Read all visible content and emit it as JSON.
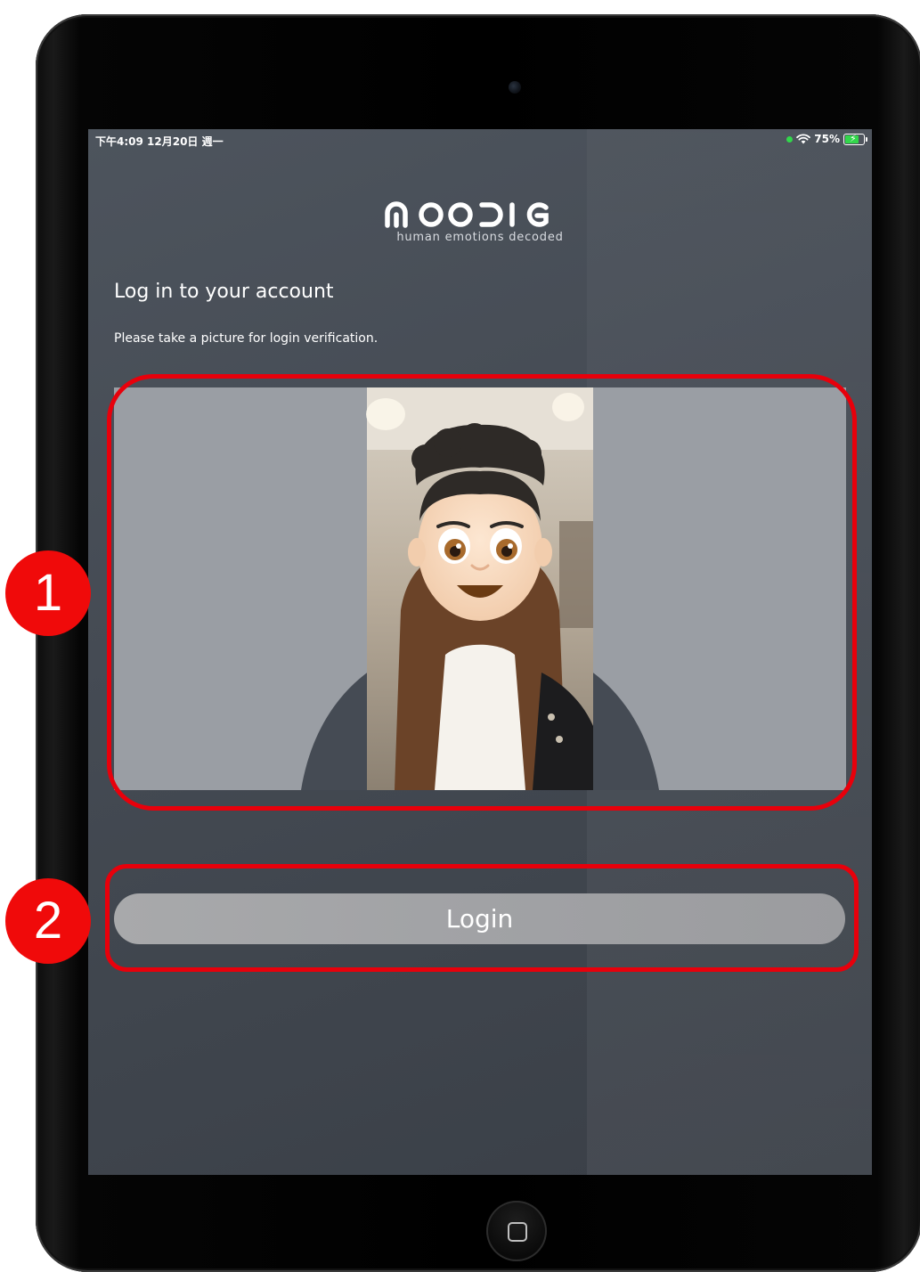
{
  "statusbar": {
    "time_date": "下午4:09  12月20日 週一",
    "battery_percent": "75%",
    "battery_level": 0.75,
    "wifi_icon": "wifi-icon",
    "battery_icon": "battery-charging-icon",
    "charge_symbol": "⚡"
  },
  "brand": {
    "name": "MOODIE",
    "tagline": "human emotions decoded"
  },
  "login": {
    "title": "Log in to your account",
    "instruction": "Please take a picture for login verification.",
    "button_label": "Login"
  },
  "annotations": {
    "marker_1": "1",
    "marker_2": "2",
    "color": "#e8000b"
  },
  "colors": {
    "screen_background": "#474d56",
    "camera_panel": "#9a9ea4",
    "button": "#a3a4a7",
    "status_green": "#32d74b"
  }
}
